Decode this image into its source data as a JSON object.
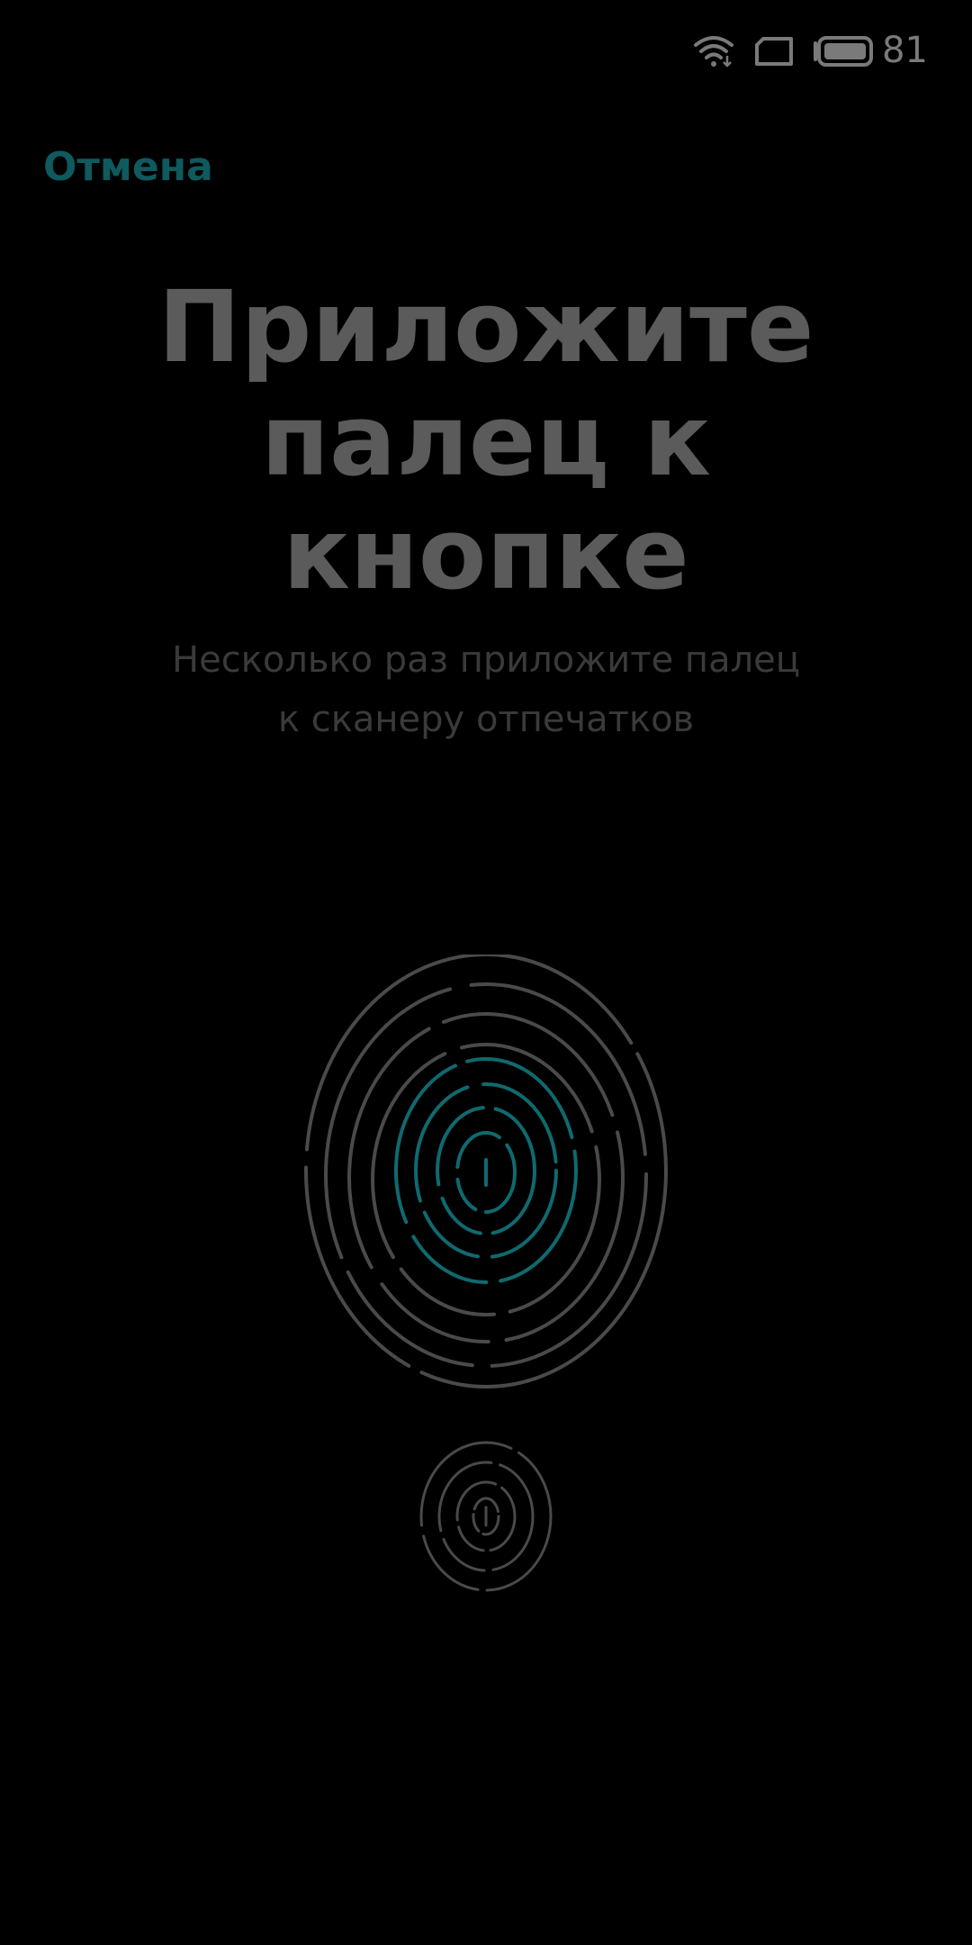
{
  "status_bar": {
    "battery_level": "81",
    "icons": [
      "wifi-icon",
      "sim-card-icon",
      "battery-icon"
    ]
  },
  "header": {
    "cancel_label": "Отмена"
  },
  "main": {
    "title": "Приложите палец к кнопке",
    "subtitle": "Несколько раз приложите палец к сканеру отпечатков"
  },
  "illustration": {
    "large_icon": "fingerprint-icon",
    "small_icon": "fingerprint-sensor-icon"
  },
  "colors": {
    "background": "#000000",
    "accent": "#0e5a5e",
    "fingerprint_active": "#0f6a6f",
    "fingerprint_inactive": "#4a4a4a",
    "title": "#5b5b5b",
    "subtitle": "#3a3a3a",
    "status_icons": "#7a7a7a"
  }
}
